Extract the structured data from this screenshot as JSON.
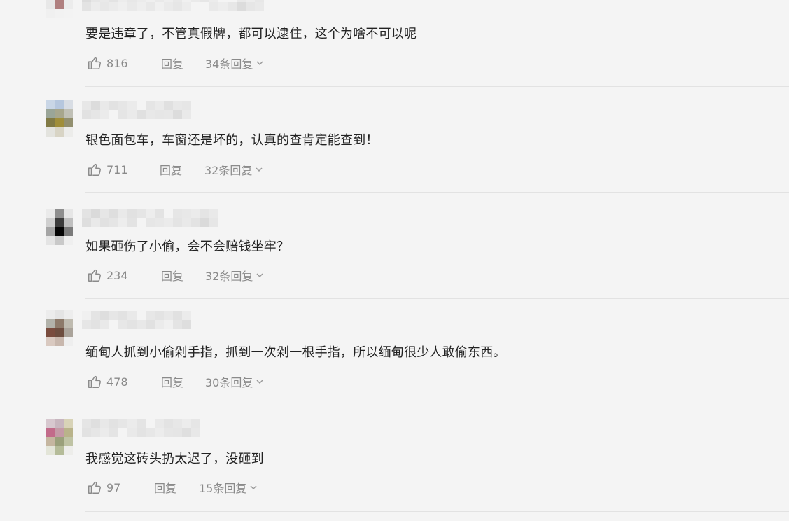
{
  "comments": [
    {
      "text": "要是违章了，不管真假牌，都可以逮住，这个为啥不可以呢",
      "likes": "816",
      "reply_label": "回复",
      "replies_label": "34条回复",
      "avatar_colors": [
        "#e6e6e6",
        "#d9c8c8",
        "#e9e9e9",
        "#e8e8e8",
        "#b08080",
        "#ececec",
        "#f0f0f0",
        "#f2f2f2",
        "#f3f3f3",
        "#f4f4f4",
        "#f4f4f4",
        "#f4f4f4"
      ]
    },
    {
      "text": "银色面包车，车窗还是坏的，认真的查肯定能查到！",
      "likes": "711",
      "reply_label": "回复",
      "replies_label": "32条回复",
      "avatar_colors": [
        "#c9d6e6",
        "#b6c7de",
        "#d8dde4",
        "#9aa598",
        "#a7a68d",
        "#c0c0b6",
        "#817a45",
        "#a08e3a",
        "#928f6f",
        "#e3e3de",
        "#d8d4c5",
        "#ececea"
      ]
    },
    {
      "text": "如果砸伤了小偷，会不会赔钱坐牢？",
      "likes": "234",
      "reply_label": "回复",
      "replies_label": "32条回复",
      "avatar_colors": [
        "#eaeaea",
        "#8f8f8f",
        "#e6e6e6",
        "#cfcfcf",
        "#3c3c3c",
        "#bfbfbf",
        "#a5a5a5",
        "#050505",
        "#7a7a7a",
        "#e4e4e4",
        "#c9c9c9",
        "#efefef"
      ]
    },
    {
      "text": "缅甸人抓到小偷剁手指，抓到一次剁一根手指，所以缅甸很少人敢偷东西。",
      "likes": "478",
      "reply_label": "回复",
      "replies_label": "30条回复",
      "avatar_colors": [
        "#ececec",
        "#e4e4e4",
        "#ededed",
        "#b2b2aa",
        "#8d7a6a",
        "#bfbbb0",
        "#7a4c3e",
        "#6d4d3f",
        "#aaa39a",
        "#d9c9c0",
        "#c8b7ad",
        "#eeeeee"
      ]
    },
    {
      "text": "我感觉这砖头扔太迟了，没砸到",
      "likes": "97",
      "reply_label": "回复",
      "replies_label": "15条回复",
      "avatar_colors": [
        "#d7c8cf",
        "#c8b6bf",
        "#d8d3b7",
        "#c26b8a",
        "#c49aa6",
        "#b9b38a",
        "#c5b6a0",
        "#9aa07b",
        "#bfc3a4",
        "#e3e5d8",
        "#b5bc99",
        "#ededea"
      ]
    }
  ]
}
